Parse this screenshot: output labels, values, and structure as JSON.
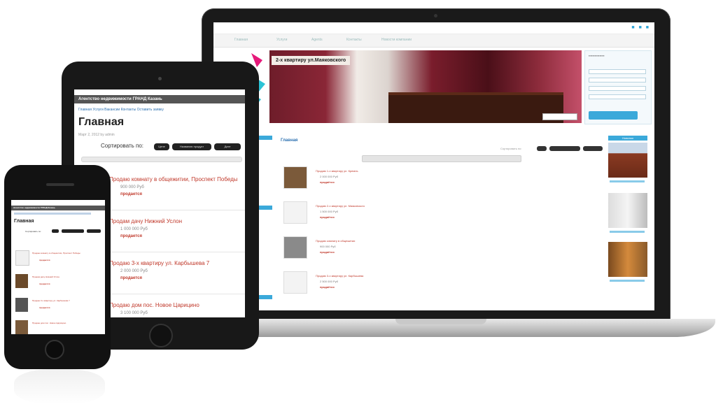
{
  "laptop": {
    "nav": [
      "Главная",
      "Услуги",
      "Agents",
      "Контакты",
      "Новости компании"
    ],
    "banner_caption": "2-х квартиру ул.Маяковского",
    "crumb": "Главная",
    "sort_label": "Сортировать по:",
    "sidebar_heading": "Новинки",
    "listings": [
      {
        "title": "Продаю 1-х квартиру ул. Кремль",
        "price": "2 000 000 Руб",
        "status": "продаётся"
      },
      {
        "title": "Продаю 2-х квартиру ул. Маяковского",
        "price": "1 500 000 Руб",
        "status": "продаётся"
      },
      {
        "title": "Продаю комнату в общежитии",
        "price": "900 000 Руб",
        "status": "продаётся"
      },
      {
        "title": "Продаю 3-х квартиру ул. Карбышева",
        "price": "2 500 000 Руб",
        "status": "продаётся"
      }
    ],
    "colors": {
      "accent": "#3ba9da",
      "link_red": "#c0392b"
    }
  },
  "tablet": {
    "header": "Агентство недвижимости ГРАНД Казань",
    "links": "Главная  Услуги  Вакансии  Контакты  Оставить заявку",
    "title": "Главная",
    "meta": "Март 2, 2012 by admin",
    "sort_label": "Сортировать по:",
    "sort_buttons": [
      "Цене",
      "Названию продукт",
      "Дате"
    ],
    "cards": [
      {
        "title": "Продаю комнату в общежитии, Проспект Победы",
        "price": "900 000 Руб",
        "status": "продается"
      },
      {
        "title": "Продам дачу Нижний Услон",
        "price": "1 000 000 Руб",
        "status": "продается"
      },
      {
        "title": "Продаю 3-х квартиру ул. Карбышева 7",
        "price": "2 000 000 Руб",
        "status": "продается"
      },
      {
        "title": "Продаю дом пос. Новое Царицино",
        "price": "3 100 000 Руб",
        "status": ""
      }
    ]
  },
  "phone": {
    "header": "Агентство недвижимости ГРАНД Казань",
    "title": "Главная",
    "sort_label": "Сортировать по:",
    "items": [
      {
        "title": "Продаю комнату в общежитии, Проспект Победы",
        "status": "продается"
      },
      {
        "title": "Продам дачу Нижний Услон",
        "status": "продается"
      },
      {
        "title": "Продаю 3-х квартиру ул. Карбышева 7",
        "status": "продается"
      },
      {
        "title": "Продаю дом пос. Новое Царицино",
        "status": "продается"
      }
    ]
  }
}
